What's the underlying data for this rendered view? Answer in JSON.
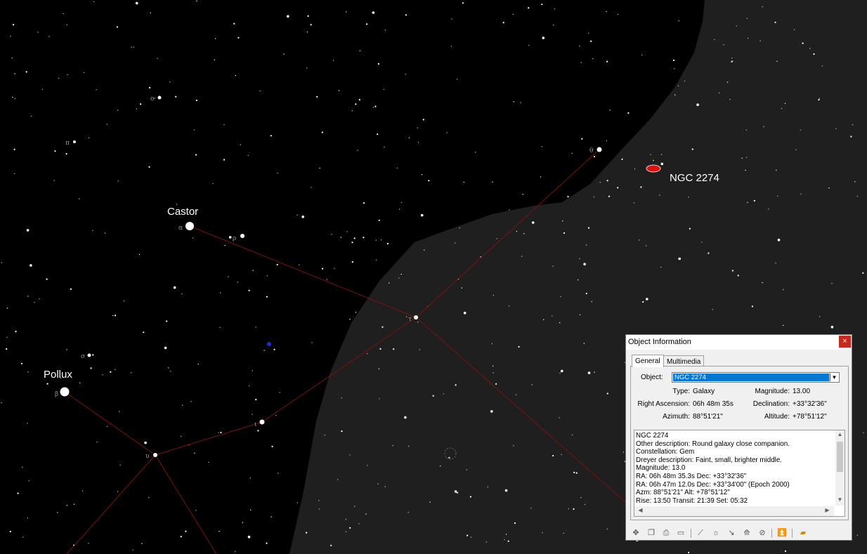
{
  "chart_labels": {
    "castor": "Castor",
    "pollux": "Pollux",
    "target": "NGC 2274",
    "greek_alpha": "α",
    "greek_beta": "β",
    "greek_theta": "θ",
    "greek_tau": "τ",
    "greek_rho": "ρ",
    "greek_upsilon": "υ",
    "greek_iota": "ι",
    "greek_sigma": "σ",
    "greek_omicron": "ο",
    "greek_pi": "π"
  },
  "colors": {
    "sky": "#000000",
    "sky_below_horizon": "#1f1f1f",
    "constellation_line": "#7a1212",
    "target_marker": "#e01010",
    "selection": "#0078d7",
    "close": "#c42b1c"
  },
  "window": {
    "title": "Object Information",
    "close_glyph": "×",
    "tabs": [
      "General",
      "Multimedia"
    ],
    "object_label": "Object:",
    "object_value": "NGC 2274",
    "type_label": "Type:",
    "type_value": "Galaxy",
    "magnitude_label": "Magnitude:",
    "magnitude_value": "13.00",
    "ra_label": "Right Ascension:",
    "ra_value": "06h 48m 35s",
    "dec_label": "Declination:",
    "dec_value": "+33°32'36\"",
    "azimuth_label": "Azimuth:",
    "azimuth_value": "88°51'21\"",
    "altitude_label": "Altitude:",
    "altitude_value": "+78°51'12\"",
    "info_lines": [
      "NGC 2274",
      "Other description: Round galaxy close companion.",
      "Constellation:  Gem",
      "Dreyer description:  Faint, small, brighter middle.",
      "Magnitude: 13.0",
      "RA: 06h 48m 35.3s  Dec: +33°32'36\"",
      "RA: 06h 47m 12.0s  Dec: +33°34'00\"  (Epoch 2000)",
      "Azm: 88°51'21\"  Alt: +78°51'12\"",
      "Rise: 13:50  Transit: 21:39  Set: 05:32"
    ]
  },
  "toolbar": {
    "icons": [
      "center-icon",
      "copy-icon",
      "print-icon",
      "book-icon",
      "telescope-icon",
      "observer-icon",
      "slew-icon",
      "sync-icon",
      "track-icon",
      "up-icon",
      "folder-icon"
    ]
  }
}
